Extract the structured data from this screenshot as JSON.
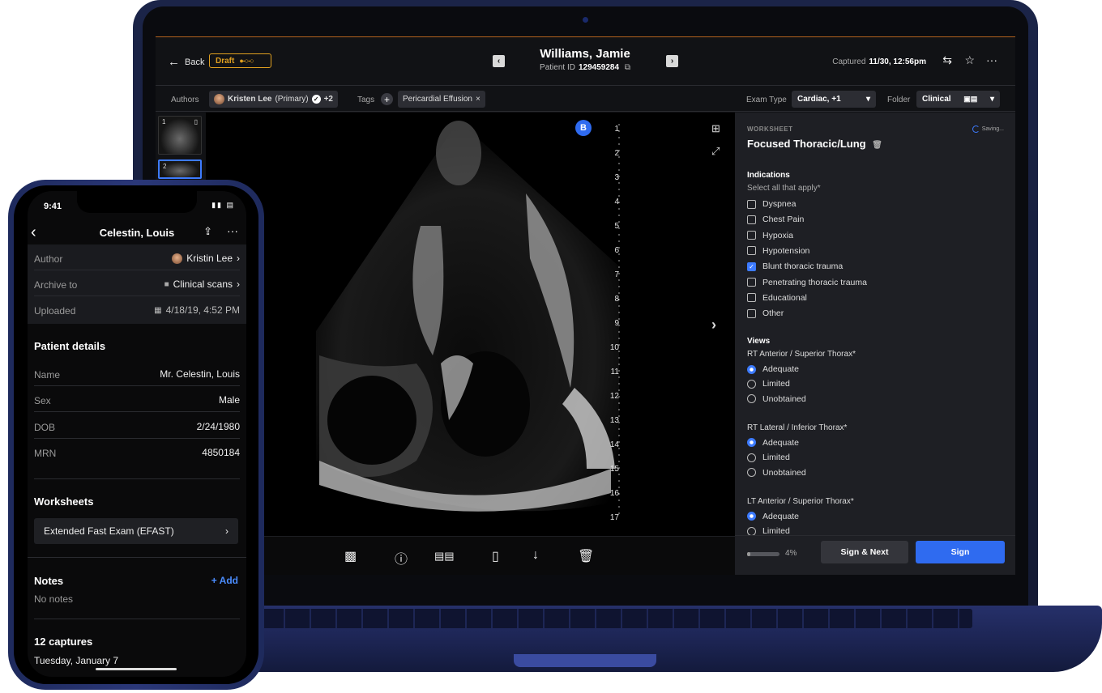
{
  "laptop": {
    "header": {
      "back_label": "Back",
      "status_badge": "Draft",
      "patient_name": "Williams, Jamie",
      "patient_id_label": "Patient ID",
      "patient_id": "129459284",
      "captured_label": "Captured",
      "captured_value": "11/30, 12:56pm"
    },
    "meta": {
      "authors_label": "Authors",
      "author_name": "Kristen Lee",
      "author_role": "(Primary)",
      "author_extra": "+2",
      "tags_label": "Tags",
      "tag": "Pericardial Effusion",
      "exam_type_label": "Exam Type",
      "exam_type_value": "Cardiac, +1",
      "folder_label": "Folder",
      "folder_value": "Clinical"
    },
    "thumbnails": [
      {
        "index": "1"
      },
      {
        "index": "2"
      }
    ],
    "viewer": {
      "badge": "B",
      "ruler_ticks": [
        "1",
        "2",
        "3",
        "4",
        "5",
        "6",
        "7",
        "8",
        "9",
        "10",
        "11",
        "12",
        "13",
        "14",
        "15",
        "16",
        "17"
      ]
    },
    "toolbar_icons": [
      "comment-icon",
      "info-icon",
      "ruler-icon",
      "bookmark-icon",
      "download-icon",
      "trash-icon"
    ],
    "worksheet": {
      "eyebrow": "WORKSHEET",
      "title": "Focused Thoracic/Lung",
      "saving": "Saving...",
      "indications_title": "Indications",
      "indications_sub": "Select all that apply*",
      "indications": [
        {
          "label": "Dyspnea",
          "checked": false
        },
        {
          "label": "Chest Pain",
          "checked": false
        },
        {
          "label": "Hypoxia",
          "checked": false
        },
        {
          "label": "Hypotension",
          "checked": false
        },
        {
          "label": "Blunt thoracic trauma",
          "checked": true
        },
        {
          "label": "Penetrating thoracic trauma",
          "checked": false
        },
        {
          "label": "Educational",
          "checked": false
        },
        {
          "label": "Other",
          "checked": false
        }
      ],
      "views_title": "Views",
      "view_groups": [
        {
          "label": "RT Anterior / Superior Thorax*",
          "options": [
            "Adequate",
            "Limited",
            "Unobtained"
          ],
          "selected": 0
        },
        {
          "label": "RT Lateral / Inferior Thorax*",
          "options": [
            "Adequate",
            "Limited",
            "Unobtained"
          ],
          "selected": 0
        },
        {
          "label": "LT Anterior / Superior Thorax*",
          "options": [
            "Adequate",
            "Limited"
          ],
          "selected": 0
        }
      ],
      "progress_fraction": 0.04,
      "progress_label": "4%",
      "sign_next_label": "Sign & Next",
      "sign_label": "Sign"
    }
  },
  "phone": {
    "status_time": "9:41",
    "title": "Celestin, Louis",
    "rows": [
      {
        "key": "Author",
        "value": "Kristin Lee"
      },
      {
        "key": "Archive to",
        "value": "Clinical scans"
      },
      {
        "key": "Uploaded",
        "value": "4/18/19, 4:52 PM"
      }
    ],
    "patient_details_title": "Patient details",
    "patient_rows": [
      {
        "key": "Name",
        "value": "Mr. Celestin, Louis"
      },
      {
        "key": "Sex",
        "value": "Male"
      },
      {
        "key": "DOB",
        "value": "2/24/1980"
      },
      {
        "key": "MRN",
        "value": "4850184"
      }
    ],
    "worksheets_title": "Worksheets",
    "worksheet_item": "Extended Fast Exam (EFAST)",
    "notes_title": "Notes",
    "add_label": "+ Add",
    "notes_empty": "No notes",
    "captures_title": "12 captures",
    "captures_date": "Tuesday, January 7"
  },
  "colors": {
    "accent_blue": "#2f6bf0",
    "draft_orange": "#e0a020",
    "device_blue": "#1b2448"
  }
}
